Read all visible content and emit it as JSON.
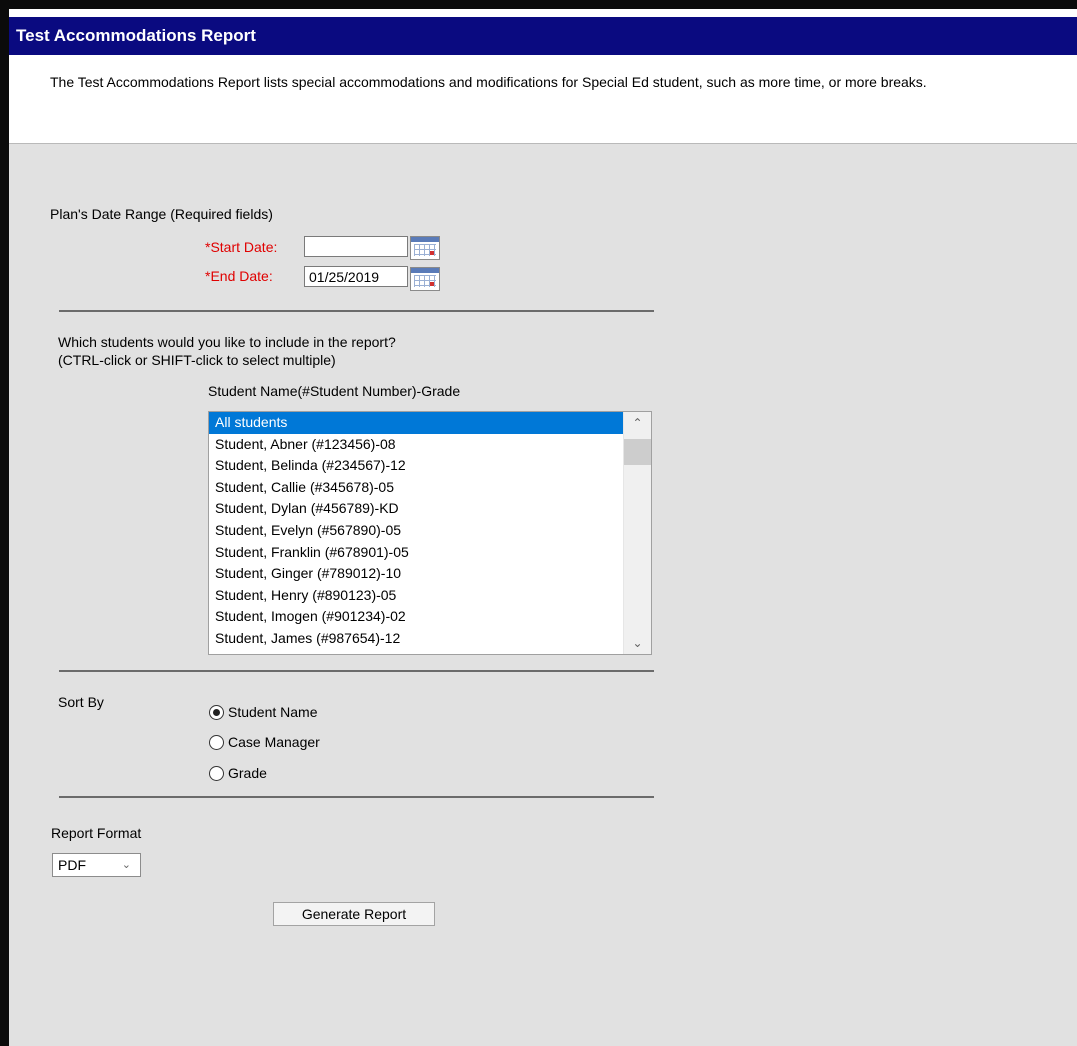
{
  "header": {
    "title": "Test Accommodations Report",
    "description": "The Test Accommodations Report lists special accommodations and modifications for Special Ed student, such as more time, or more breaks."
  },
  "date_range": {
    "heading": "Plan's Date Range (Required fields)",
    "start_label": "*Start Date:",
    "start_value": "",
    "end_label": "*End Date:",
    "end_value": "01/25/2019"
  },
  "students": {
    "question_line1": "Which students would you like to include in the report?",
    "question_line2": "(CTRL-click or SHIFT-click to select multiple)",
    "column_header": "Student Name(#Student Number)-Grade",
    "options": [
      "All students",
      "Student, Abner (#123456)-08",
      "Student, Belinda (#234567)-12",
      "Student, Callie (#345678)-05",
      "Student, Dylan (#456789)-KD",
      "Student, Evelyn (#567890)-05",
      "Student, Franklin (#678901)-05",
      "Student, Ginger (#789012)-10",
      "Student, Henry (#890123)-05",
      "Student, Imogen (#901234)-02",
      "Student, James (#987654)-12"
    ],
    "selected": "All students"
  },
  "sort_by": {
    "label": "Sort By",
    "options": [
      "Student Name",
      "Case Manager",
      "Grade"
    ],
    "selected": "Student Name"
  },
  "report_format": {
    "label": "Report Format",
    "value": "PDF"
  },
  "actions": {
    "generate_label": "Generate Report"
  },
  "icons": {
    "calendar": "calendar-icon",
    "scroll_up": "chevron-up-icon",
    "scroll_down": "chevron-down-icon",
    "dropdown": "chevron-down-icon"
  },
  "colors": {
    "title_bar": "#0a0a80",
    "panel_bg": "#e1e1e1",
    "required_label": "#e00000",
    "selection": "#0078d7"
  }
}
